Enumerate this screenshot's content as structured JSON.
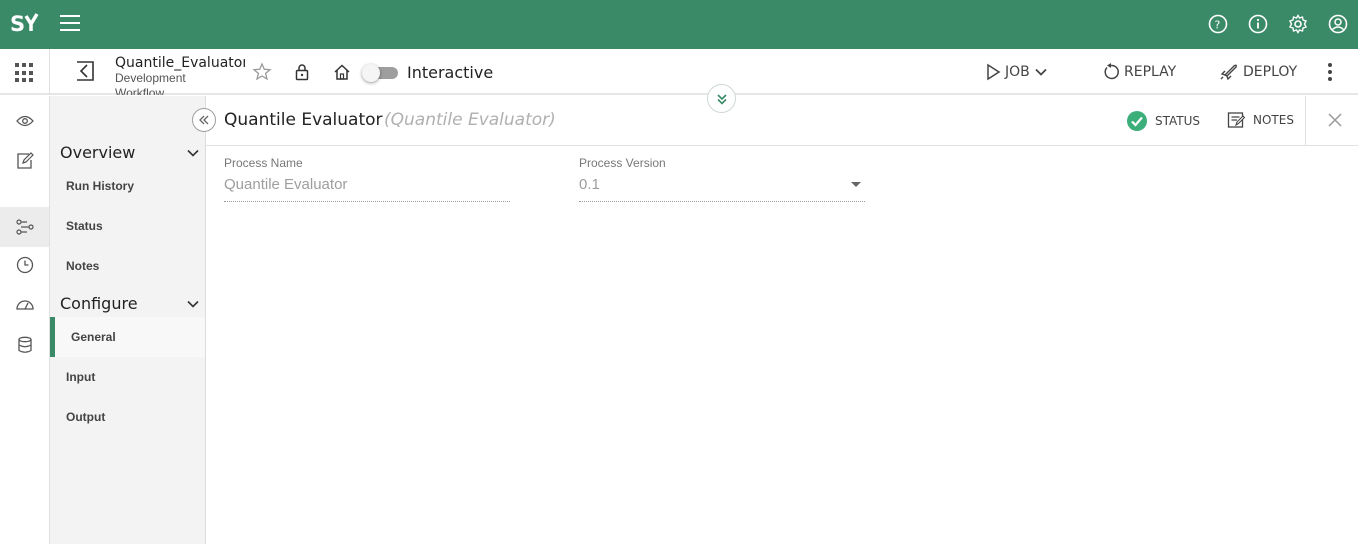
{
  "brand": {
    "logo_text": "SY",
    "accent": "#3a8a68"
  },
  "topbar": {
    "icons": [
      "help-icon",
      "info-icon",
      "settings-icon",
      "account-icon"
    ]
  },
  "appbar": {
    "workflow_title": "Quantile_Evaluator",
    "workflow_subtitle": "Development",
    "workflow_subtitle2": "Workflow",
    "interactive_label": "Interactive",
    "interactive_on": false,
    "job_label": "JOB",
    "replay_label": "REPLAY",
    "deploy_label": "DEPLOY"
  },
  "rail": {
    "items": [
      "view-icon",
      "edit-icon",
      "flow-icon",
      "history-icon",
      "dashboard-icon",
      "storage-icon"
    ]
  },
  "nav": {
    "overview": {
      "label": "Overview",
      "items": [
        {
          "label": "Run History"
        },
        {
          "label": "Status"
        },
        {
          "label": "Notes"
        }
      ]
    },
    "configure": {
      "label": "Configure",
      "items": [
        {
          "label": "General"
        },
        {
          "label": "Input"
        },
        {
          "label": "Output"
        }
      ]
    }
  },
  "main": {
    "title": "Quantile Evaluator",
    "subtitle": "(Quantile Evaluator)",
    "status_label": "STATUS",
    "notes_label": "NOTES",
    "process_name_label": "Process Name",
    "process_name_value": "Quantile Evaluator",
    "process_version_label": "Process Version",
    "process_version_value": "0.1"
  }
}
